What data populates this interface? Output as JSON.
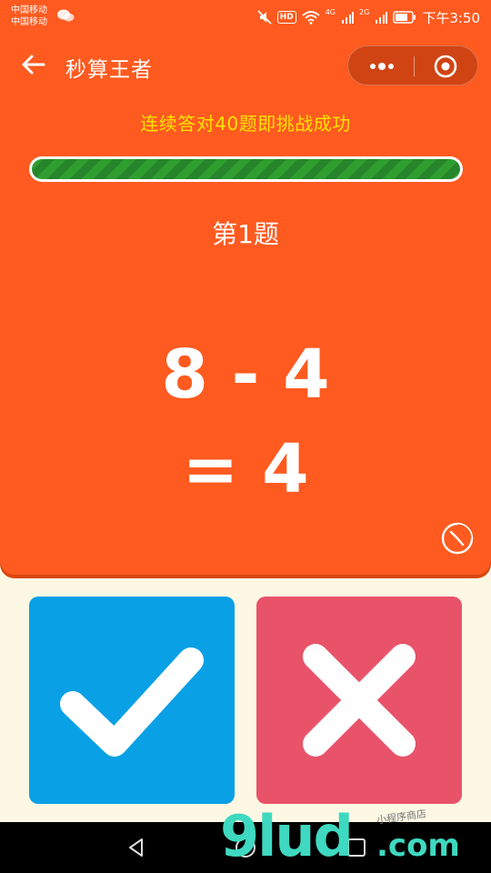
{
  "status_bar": {
    "carrier_1": "中国移动",
    "carrier_2": "中国移动",
    "hd": "HD",
    "network_1": "4G",
    "network_2": "2G",
    "time": "下午3:50"
  },
  "header": {
    "title": "秒算王者",
    "back_icon": "back-arrow-icon",
    "more_icon": "more-dots-icon",
    "close_icon": "target-close-icon"
  },
  "game": {
    "goal_text": "连续答对40题即挑战成功",
    "progress_fraction": 1.0,
    "question_label": "第1题",
    "expression": "8 - 4",
    "answer": "= 4",
    "timer_icon": "timer-icon"
  },
  "answers": {
    "correct_icon": "check-icon",
    "wrong_icon": "cross-icon"
  },
  "nav": {
    "back_icon": "nav-back-icon",
    "home_icon": "nav-home-icon",
    "recent_icon": "nav-recent-icon"
  },
  "watermark": {
    "main": "9lud",
    "com": ".com",
    "tag": "小程序商店"
  },
  "colors": {
    "panel": "#ff5a1f",
    "goal_text": "#ffe400",
    "progress": "#2f9e2f",
    "correct": "#0aa0e6",
    "wrong": "#e8536a",
    "background": "#fdf8e4"
  }
}
